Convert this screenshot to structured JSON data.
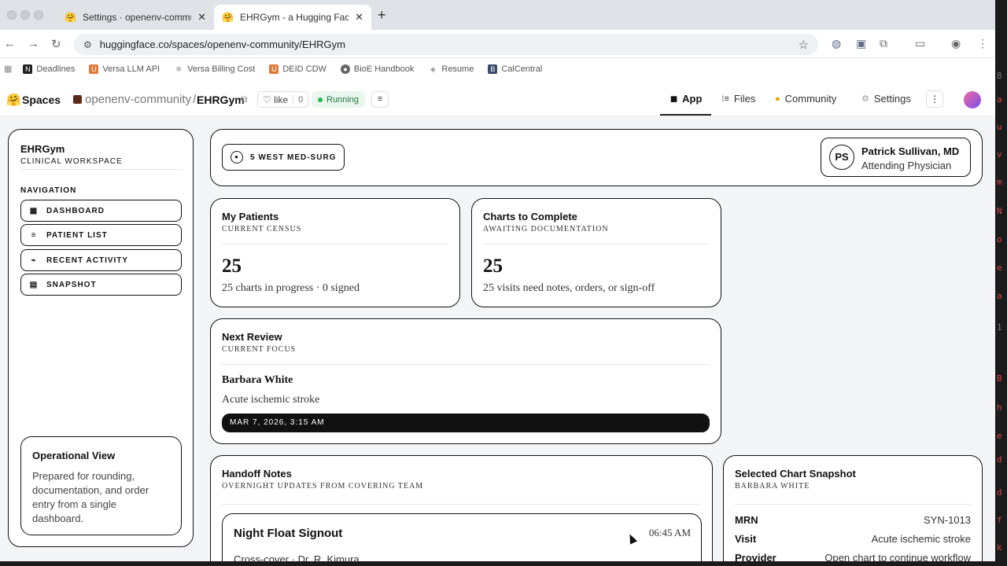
{
  "browser": {
    "tabs": [
      {
        "title": "Settings · openenv-communit",
        "active": false
      },
      {
        "title": "EHRGym - a Hugging Face Sp",
        "active": true
      }
    ],
    "url": "huggingface.co/spaces/openenv-community/EHRGym",
    "bookmarks": [
      "Deadlines",
      "Versa LLM API",
      "Versa Billing Cost",
      "DEID CDW",
      "BioE Handbook",
      "Resume",
      "CalCentral"
    ]
  },
  "hf": {
    "spaces_label": "Spaces",
    "org": "openenv-community",
    "separator": "/",
    "repo": "EHRGym",
    "like_label": "like",
    "like_count": "0",
    "status": "Running",
    "tabs": [
      "App",
      "Files",
      "Community",
      "Settings"
    ]
  },
  "sidebar": {
    "title": "EHRGym",
    "subtitle": "CLINICAL WORKSPACE",
    "nav_heading": "NAVIGATION",
    "items": [
      "DASHBOARD",
      "PATIENT LIST",
      "RECENT ACTIVITY",
      "SNAPSHOT"
    ],
    "operational": {
      "title": "Operational View",
      "text": "Prepared for rounding, documentation, and order entry from a single dashboard."
    }
  },
  "header": {
    "unit": "5 WEST MED-SURG",
    "user_initials": "PS",
    "user_name": "Patrick Sullivan, MD",
    "user_role": "Attending Physician"
  },
  "patients": {
    "title": "My Patients",
    "subtitle": "CURRENT CENSUS",
    "count": "25",
    "desc": "25 charts in progress · 0 signed"
  },
  "charts": {
    "title": "Charts to Complete",
    "subtitle": "AWAITING DOCUMENTATION",
    "count": "25",
    "desc": "25 visits need notes, orders, or sign-off"
  },
  "review": {
    "title": "Next Review",
    "subtitle": "CURRENT FOCUS",
    "patient": "Barbara White",
    "diagnosis": "Acute ischemic stroke",
    "datetime": "MAR 7, 2026, 3:15 AM"
  },
  "handoff": {
    "title": "Handoff Notes",
    "subtitle": "OVERNIGHT UPDATES FROM COVERING TEAM",
    "note_title": "Night Float Signout",
    "note_time": "06:45 AM",
    "note_byline": "Cross-cover · Dr. R. Kimura"
  },
  "snapshot": {
    "title": "Selected Chart Snapshot",
    "subtitle": "BARBARA WHITE",
    "rows": [
      {
        "k": "MRN",
        "v": "SYN-1013"
      },
      {
        "k": "Visit",
        "v": "Acute ischemic stroke"
      },
      {
        "k": "Provider",
        "v": "Open chart to continue workflow"
      }
    ]
  }
}
